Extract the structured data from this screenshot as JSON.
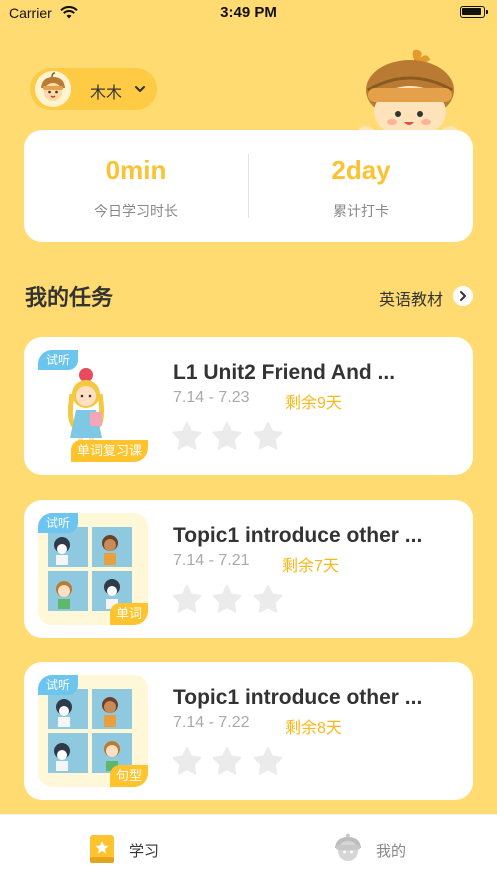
{
  "status_bar": {
    "carrier": "Carrier",
    "time": "3:49 PM"
  },
  "user": {
    "name": "木木"
  },
  "stats": [
    {
      "value": "0min",
      "label": "今日学习时长"
    },
    {
      "value": "2day",
      "label": "累计打卡"
    }
  ],
  "section": {
    "title": "我的任务",
    "link_label": "英语教材"
  },
  "tasks": [
    {
      "badge": "试听",
      "type_badge": "单词复习课",
      "title": "L1 Unit2 Friend And ...",
      "dates": "7.14 - 7.23",
      "remaining": "剩余9天",
      "stars_earned": 0,
      "stars_total": 3
    },
    {
      "badge": "试听",
      "type_badge": "单词",
      "title": "Topic1 introduce other ...",
      "dates": "7.14 - 7.21",
      "remaining": "剩余7天",
      "stars_earned": 0,
      "stars_total": 3
    },
    {
      "badge": "试听",
      "type_badge": "句型",
      "title": "Topic1 introduce other ...",
      "dates": "7.14 - 7.22",
      "remaining": "剩余8天",
      "stars_earned": 0,
      "stars_total": 3
    }
  ],
  "tab_bar": {
    "items": [
      {
        "label": "学习",
        "icon": "book-star-icon",
        "active": true
      },
      {
        "label": "我的",
        "icon": "profile-mascot-icon",
        "active": false
      }
    ]
  },
  "colors": {
    "background": "#FFDB72",
    "accent": "#FBC233",
    "trial_badge": "#6BC5EE",
    "remaining_text": "#F9B81A"
  }
}
